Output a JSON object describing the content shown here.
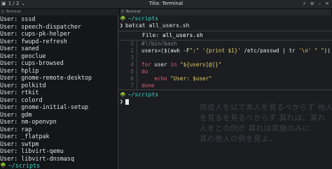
{
  "titlebar": {
    "tab_indicator": "1 / 2",
    "title": "Tilix: Terminal",
    "left_pane_title": "1: Terminal",
    "right_pane_title": "2: Terminal"
  },
  "left_pane": {
    "lines": [
      "User: sssd",
      "User: speech-dispatcher",
      "User: cups-pk-helper",
      "User: fwupd-refresh",
      "User: saned",
      "User: geoclue",
      "User: cups-browsed",
      "User: hplip",
      "User: gnome-remote-desktop",
      "User: polkitd",
      "User: rtkit",
      "User: colord",
      "User: gnome-initial-setup",
      "User: gdm",
      "User: nm-openvpn",
      "User: rap",
      "User: _flatpak",
      "User: swtpm",
      "User: libvirt-qemu",
      "User: libvirt-dnsmasq"
    ],
    "prompt_dir": "~/scripts"
  },
  "right_pane": {
    "prompt_dir": "~/scripts",
    "command": "batcat all_users.sh",
    "file_label": "File:",
    "file_name": "all_users.sh",
    "code_lines": [
      {
        "n": "1",
        "text": "#!/bin/bash"
      },
      {
        "n": "2",
        "text": "users=($(awk -F\":\" '{print $1}' /etc/passwd | tr '\\n' \" \"))"
      },
      {
        "n": "3",
        "text": ""
      },
      {
        "n": "4",
        "text": "for user in \"${users[@]}\""
      },
      {
        "n": "5",
        "text": "do"
      },
      {
        "n": "6",
        "text": "    echo \"User: $user\""
      },
      {
        "n": "7",
        "text": "done"
      }
    ],
    "prompt_dir_2": "~/scripts"
  },
  "overlay_text": [
    "完成人を以て本人を見るべからず 他人",
    "を見るを見るべからず 其れは、其れ",
    "人をとの例示 其れは実施のみに",
    "  其の他人の例を見よ。"
  ],
  "colors": {
    "prompt": "#3ed6d0",
    "keyword": "#e05b7a",
    "string": "#e3cf6d",
    "comment": "#80858b",
    "background": "#1b1d20"
  }
}
